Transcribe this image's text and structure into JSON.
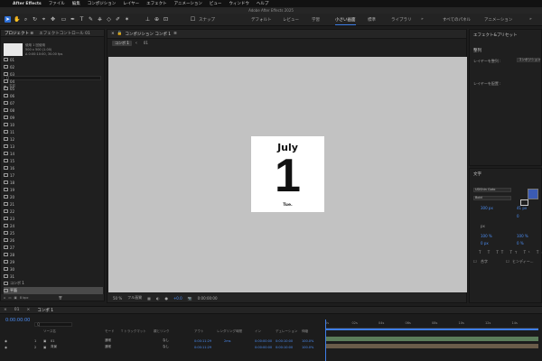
{
  "mac_menu": [
    "After Effects",
    "ファイル",
    "編集",
    "コンポジション",
    "レイヤー",
    "エフェクト",
    "アニメーション",
    "ビュー",
    "ウィンドウ",
    "ヘルプ"
  ],
  "window_title": "Adobe After Effects 2025",
  "toolbar": {
    "snap_label": "スナップ",
    "workspaces": [
      "デフォルト",
      "レビュー",
      "学習",
      "小さい画面",
      "標準",
      "ライブラリ",
      "»",
      "すべてのパネル",
      "アニメーション",
      "»"
    ],
    "active_workspace_index": 3
  },
  "project_panel": {
    "tabs": [
      "プロジェクト ≡",
      "エフェクトコントロール 01"
    ],
    "thumb_meta": [
      "使用 1 回使用",
      "500 x 500 (1.00)",
      "Δ 0:00:10:00, 30.00 fps"
    ],
    "search_placeholder": "Q",
    "header_name": "名前",
    "items": [
      "01",
      "02",
      "03",
      "04",
      "05",
      "06",
      "07",
      "08",
      "09",
      "10",
      "11",
      "12",
      "13",
      "14",
      "15",
      "16",
      "17",
      "18",
      "19",
      "20",
      "21",
      "22",
      "23",
      "24",
      "25",
      "26",
      "27",
      "28",
      "29",
      "30",
      "31",
      "コンポ 1",
      "平面"
    ],
    "selected_index": 32,
    "footer_bpc": "8 bpc"
  },
  "comp_panel": {
    "tab_label": "コンポジション コンポ 1",
    "tab_menu": "≡",
    "breadcrumbs": [
      "コンポ 1",
      "01"
    ],
    "footer": {
      "zoom": "50 %",
      "quality": "フル画質",
      "exposure": "+0.0",
      "timecode": "0:00:00:00"
    }
  },
  "calendar": {
    "month": "July",
    "day": "1",
    "weekday": "Tue."
  },
  "effects_panel": {
    "title": "エフェクト&プリセット",
    "align_title": "整列",
    "align_to_label": "レイヤーを整列 :",
    "align_to_value": "コンポジション",
    "distribute_label": "レイヤーを配置 :"
  },
  "text_panel": {
    "title": "文字",
    "font": "UDShin Goto",
    "style": "Bold",
    "size": "300 px",
    "leading": "41 px",
    "tracking": "0",
    "unit": "px",
    "vscale": "100 %",
    "hscale": "100 %",
    "baseline": "0 px",
    "tsume": "0 %",
    "ligatures_label": "合字",
    "hindi_label": "ヒンディー..."
  },
  "timeline": {
    "tabs": [
      "01",
      "コンポ 1"
    ],
    "time": "0:00:00:00",
    "fps_note": "00000 (30.00 fps)",
    "search_placeholder": "Q",
    "columns": [
      "ソース名",
      "モード",
      "T トラックマット",
      "親とリンク",
      "アウト",
      "レンダリング時間",
      "イン",
      "デュレーション",
      "伸縮"
    ],
    "layers": [
      {
        "num": "1",
        "name": "01",
        "mode": "通常",
        "parent": "なし",
        "out": "0:00:11:29",
        "render": "2ms",
        "in": "0:00:00:00",
        "duration": "0:00:10:00",
        "stretch": "100.0%"
      },
      {
        "num": "2",
        "name": "背景",
        "mode": "通常",
        "parent": "なし",
        "out": "0:00:11:29",
        "render": "",
        "in": "0:00:00:00",
        "duration": "0:00:10:00",
        "stretch": "100.0%"
      }
    ],
    "ruler_ticks": [
      "0s",
      "02s",
      "04s",
      "06s",
      "08s",
      "10s",
      "12s",
      "14s"
    ]
  }
}
